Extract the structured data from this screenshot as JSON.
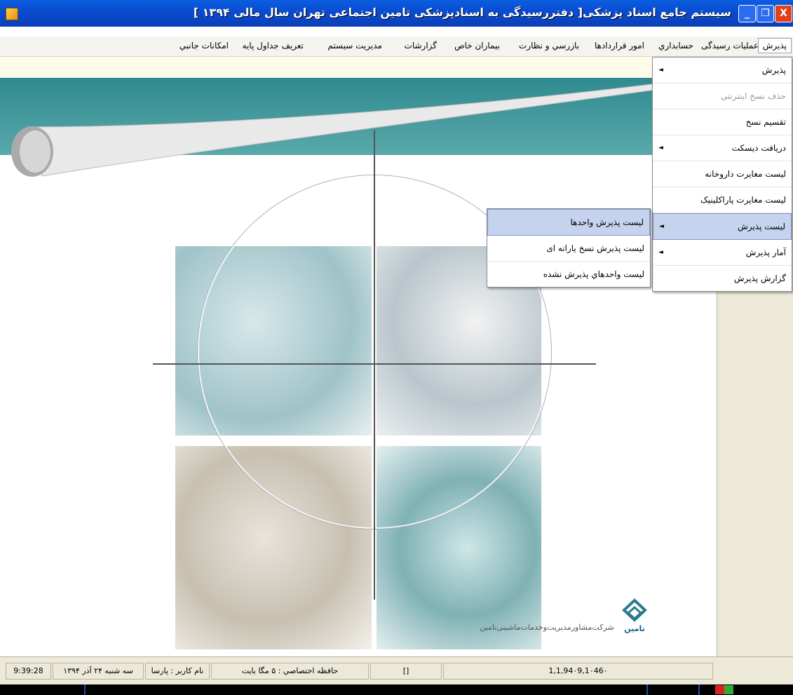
{
  "window": {
    "title": "سیستم جامع اسناد پزشکی[ دفتررسیدگی به اسنادپزشکی تامین اجتماعی تهران  سال مالی  ۱۳۹۴ ]",
    "close_glyph": "X",
    "restore_glyph": "❐",
    "minimize_glyph": "_"
  },
  "menubar": {
    "items": [
      "پذیرش",
      "عملیات رسیدگی",
      "حسابداري",
      "امور قراردادها",
      "بازرسي و نظارت",
      "بیماران خاص",
      "گزارشات",
      "مديريت سيستم",
      "تعريف جداول پايه",
      "امكانات جانبي"
    ]
  },
  "submenu": {
    "items": [
      {
        "label": "پذیرش",
        "arrow": "◄"
      },
      {
        "label": "حذف نسخ اینترنتی",
        "arrow": ""
      },
      {
        "label": "تقسیم نسخ",
        "arrow": ""
      },
      {
        "label": "دریافت دیسکت",
        "arrow": "◄"
      },
      {
        "label": "لیست مغایرت داروخانه",
        "arrow": ""
      },
      {
        "label": "لیست مغایرت پاراکلینیک",
        "arrow": ""
      },
      {
        "label": "لیست پذیرش",
        "arrow": "◄"
      },
      {
        "label": "آمار پذیرش",
        "arrow": "◄"
      },
      {
        "label": "گزارش پذیرش",
        "arrow": ""
      }
    ]
  },
  "subsubmenu": {
    "items": [
      "لیست پذیرش واحدها",
      "لیست پذیرش نسخ یارانه ای",
      "لیست واحدهاي پذيرش نشده"
    ]
  },
  "company": {
    "name": "شرکت‌مشاورمدیریت‌وخدمات‌ماشینی‌تامین",
    "logo_text": "تامین"
  },
  "statusbar": {
    "time": "9:39:28",
    "date": "سه شنبه ۲۴ آذر ۱۳۹۴",
    "user": "نام کاربر : پارسا",
    "memory": "حافظه اختصاصي : ۵ مگا بايت",
    "indicator": "[]",
    "number": "1,1,94٠9,1٠46٠"
  }
}
